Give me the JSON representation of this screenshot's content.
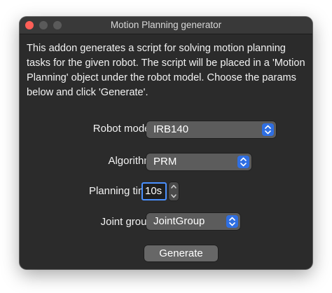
{
  "window": {
    "title": "Motion Planning generator"
  },
  "description": "This addon generates a script for solving motion planning tasks for the given robot. The script will be placed in a 'Motion Planning' object under the robot model. Choose the params below and click 'Generate'.",
  "form": {
    "robot_model": {
      "label": "Robot model:",
      "value": "IRB140",
      "icon": "popup-arrows-icon"
    },
    "algorithm": {
      "label": "Algorithm:",
      "value": "PRM",
      "icon": "popup-arrows-icon"
    },
    "planning_time": {
      "label": "Planning time:",
      "value": "10s",
      "icon": "stepper-icon"
    },
    "joint_group": {
      "label": "Joint group:",
      "value": "JointGroup",
      "icon": "popup-arrows-icon"
    }
  },
  "actions": {
    "generate_label": "Generate"
  },
  "colors": {
    "window_bg": "#2b2b2b",
    "accent": "#2f6fe3",
    "focus_ring": "#4a90ff",
    "close_button": "#ff5f57"
  }
}
